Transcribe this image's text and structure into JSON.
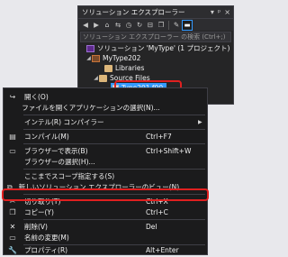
{
  "solution_explorer": {
    "title": "ソリューション エクスプローラー",
    "title_controls": [
      "▾",
      "ᵖ",
      "×"
    ],
    "toolbar_icons": [
      "back-icon",
      "forward-icon",
      "home-icon",
      "sync-icon",
      "history-icon",
      "refresh-icon",
      "collapse-icon",
      "copy-icon",
      "wrench-icon",
      "show-all-icon"
    ],
    "search_placeholder": "ソリューション エクスプローラー の検索 (Ctrl+;)",
    "tree": [
      {
        "label": "ソリューション 'MyType' (1 プロジェクト)",
        "icon": "solution-icon",
        "level": 0
      },
      {
        "label": "MyType202",
        "icon": "project-icon",
        "level": 1
      },
      {
        "label": "Libraries",
        "icon": "folder-icon",
        "level": 2
      },
      {
        "label": "Source Files",
        "icon": "folder-icon",
        "level": 2
      },
      {
        "label": "Type201.f90",
        "icon": "file-icon",
        "level": 3
      }
    ]
  },
  "context_menu": {
    "items": [
      {
        "label": "開く(O)",
        "shortcut": "",
        "icon": "open-icon"
      },
      {
        "label": "ファイルを開くアプリケーションの選択(N)...",
        "shortcut": "",
        "icon": ""
      },
      {
        "label": "インテル(R) コンパイラー",
        "shortcut": "",
        "icon": "",
        "submenu": true
      },
      {
        "label": "コンパイル(M)",
        "shortcut": "Ctrl+F7",
        "icon": "compile-icon"
      },
      {
        "label": "ブラウザーで表示(B)",
        "shortcut": "Ctrl+Shift+W",
        "icon": "browser-icon"
      },
      {
        "label": "ブラウザーの選択(H)...",
        "shortcut": "",
        "icon": ""
      },
      {
        "label": "ここまでスコープ指定する(S)",
        "shortcut": "",
        "icon": ""
      },
      {
        "label": "新しいソリューション エクスプローラーのビュー(N)",
        "shortcut": "",
        "icon": "new-view-icon"
      },
      {
        "label": "切り取り(T)",
        "shortcut": "Ctrl+X",
        "icon": "cut-icon"
      },
      {
        "label": "コピー(Y)",
        "shortcut": "Ctrl+C",
        "icon": "copy-icon"
      },
      {
        "label": "削除(V)",
        "shortcut": "Del",
        "icon": "delete-icon"
      },
      {
        "label": "名前の変更(M)",
        "shortcut": "",
        "icon": "rename-icon"
      },
      {
        "label": "プロパティ(R)",
        "shortcut": "Alt+Enter",
        "icon": "properties-icon"
      }
    ]
  }
}
